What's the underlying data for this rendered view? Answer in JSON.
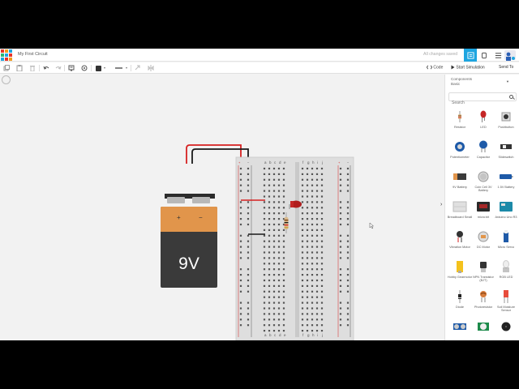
{
  "header": {
    "project_title": "My First Circuit",
    "save_status": "All changes saved"
  },
  "toolbar": {
    "code_label": "Code",
    "start_simulation_label": "Start Simulation",
    "export_label": "Send To"
  },
  "sidebar": {
    "category_group": "Components",
    "category_value": "Basic",
    "search_placeholder": "Search",
    "components": [
      {
        "label": "Resistor"
      },
      {
        "label": "LED"
      },
      {
        "label": "Pushbutton"
      },
      {
        "label": "Potentiometer"
      },
      {
        "label": "Capacitor"
      },
      {
        "label": "Slideswitch"
      },
      {
        "label": "9V Battery"
      },
      {
        "label": "Coin Cell 3V Battery"
      },
      {
        "label": "1.5V Battery"
      },
      {
        "label": "Breadboard Small"
      },
      {
        "label": "micro:bit"
      },
      {
        "label": "Arduino Uno R3"
      },
      {
        "label": "Vibration Motor"
      },
      {
        "label": "DC Motor"
      },
      {
        "label": "Micro Servo"
      },
      {
        "label": "Hobby Gearmotor"
      },
      {
        "label": "NPN Transistor (BJT)"
      },
      {
        "label": "RGB LED"
      },
      {
        "label": "Diode"
      },
      {
        "label": "Photoresistor"
      },
      {
        "label": "Soil Moisture Sensor"
      }
    ]
  },
  "battery": {
    "voltage_label": "9V",
    "plus_label": "+",
    "minus_label": "−"
  },
  "breadboard": {
    "column_letters_left": [
      "a",
      "b",
      "c",
      "d",
      "e"
    ],
    "column_letters_right": [
      "f",
      "g",
      "h",
      "i",
      "j"
    ],
    "rail_plus": "+",
    "rail_minus": "−"
  },
  "colors": {
    "brand_blue": "#1ea5e0",
    "battery_body": "#3a3a3a",
    "battery_label": "#e1954b",
    "wire_red": "#d62121",
    "wire_black": "#1a1a1a",
    "led_red": "#b01c1c"
  }
}
